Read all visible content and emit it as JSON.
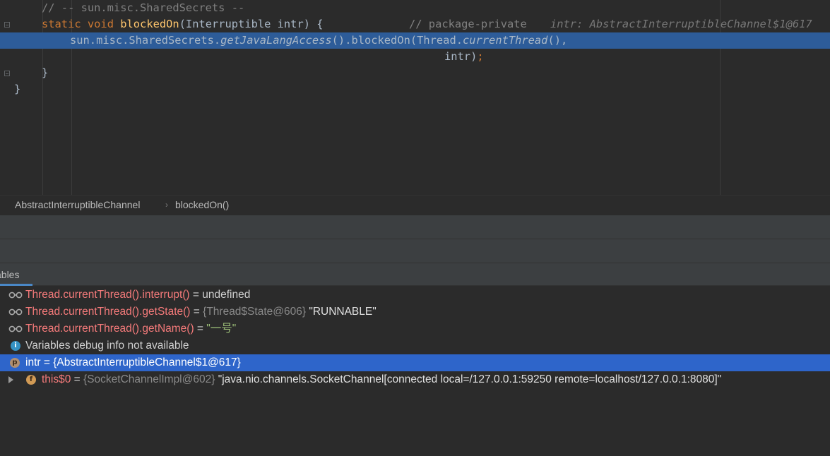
{
  "editor": {
    "line1_comment": "// -- sun.misc.SharedSecrets --",
    "line2": {
      "kw_static": "static",
      "kw_void": "void",
      "method": "blockedOn",
      "params": "(Interruptible intr) {",
      "comment": "// package-private",
      "hint": "intr: AbstractInterruptibleChannel$1@617"
    },
    "line3": {
      "prefix": "sun.misc.SharedSecrets.",
      "method": "getJavaLangAccess",
      "mid": "().blockedOn(Thread.",
      "method2": "currentThread",
      "suffix": "(),"
    },
    "line4": {
      "arg": "intr)",
      "semi": ";"
    },
    "line5": "}",
    "line6": "}"
  },
  "breadcrumb": {
    "class_name": "AbstractInterruptibleChannel",
    "separator": "›",
    "method_name": "blockedOn()"
  },
  "variables_tab": {
    "label": "ables"
  },
  "variables": [
    {
      "icon": "watch-glasses-icon",
      "expr": "Thread.currentThread().interrupt()",
      "eq": " = ",
      "value": "undefined"
    },
    {
      "icon": "watch-glasses-icon",
      "expr": "Thread.currentThread().getState()",
      "eq": " = ",
      "type": "{Thread$State@606}",
      "value": " \"RUNNABLE\""
    },
    {
      "icon": "watch-glasses-icon",
      "expr": "Thread.currentThread().getName()",
      "eq": " = ",
      "value": "\"一号\""
    },
    {
      "icon": "info-icon",
      "icon_letter": "i",
      "text": "Variables debug info not available"
    },
    {
      "icon": "parameter-icon",
      "icon_letter": "p",
      "text": "intr = {AbstractInterruptibleChannel$1@617}"
    },
    {
      "icon": "field-icon",
      "icon_letter": "f",
      "name": "this$0",
      "eq": " = ",
      "type": "{SocketChannelImpl@602}",
      "value": " \"java.nio.channels.SocketChannel[connected local=/127.0.0.1:59250 remote=localhost/127.0.0.1:8080]\""
    }
  ],
  "colors": {
    "editor_bg": "#2b2b2b",
    "selection": "#2d5c99",
    "variable_selection": "#2e65ca",
    "watch_expr": "#f47a7a",
    "keyword": "#cc7832",
    "method": "#ffc66d"
  }
}
